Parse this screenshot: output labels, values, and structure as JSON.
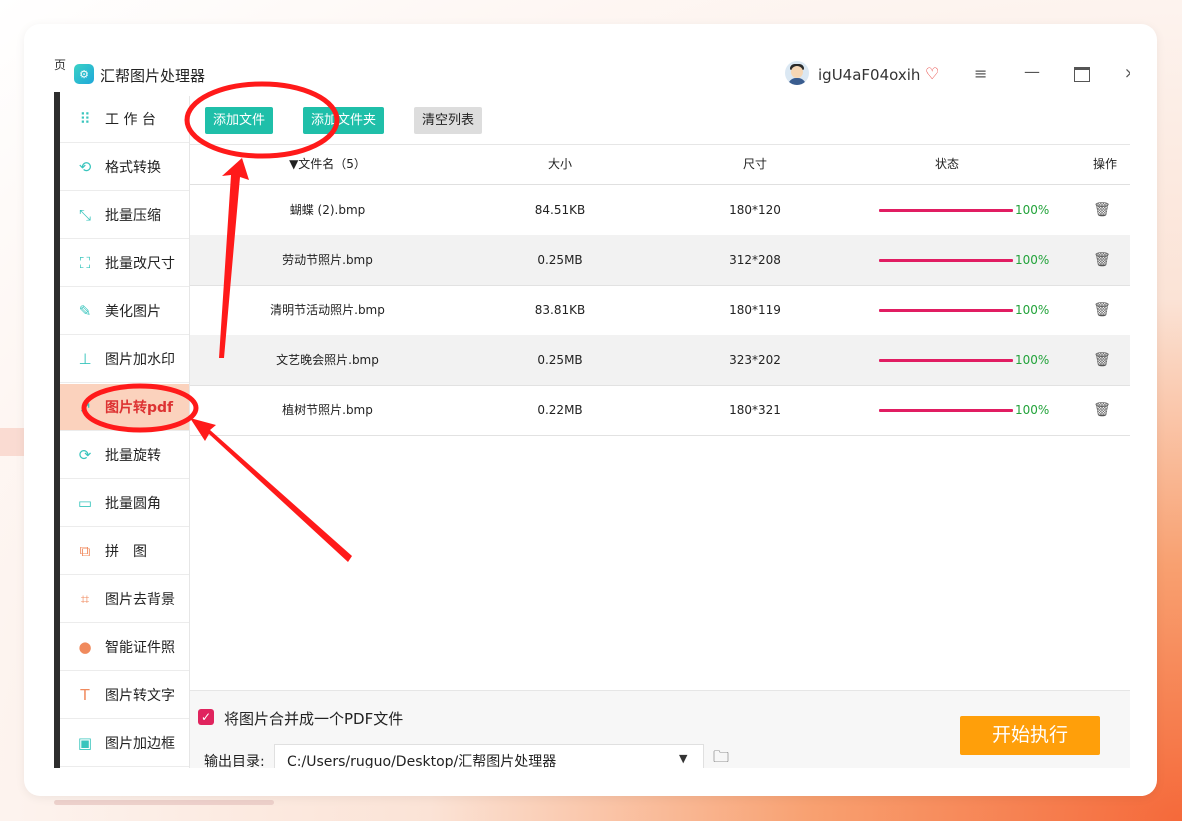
{
  "app": {
    "title": "汇帮图片处理器",
    "logo_glyph": "⚙",
    "edge_glyph": "页"
  },
  "user": {
    "name": "igU4aF04oxih"
  },
  "window_controls": {
    "menu": "≡",
    "minimize": "—",
    "close": "×"
  },
  "sidebar": {
    "items": [
      {
        "label": "工 作 台",
        "icon": "grid-icon",
        "glyph": "⠿"
      },
      {
        "label": "格式转换",
        "icon": "convert-icon",
        "glyph": "⟲"
      },
      {
        "label": "批量压缩",
        "icon": "compress-icon",
        "glyph": "⤡"
      },
      {
        "label": "批量改尺寸",
        "icon": "resize-icon",
        "glyph": "⛶"
      },
      {
        "label": "美化图片",
        "icon": "beautify-icon",
        "glyph": "✎"
      },
      {
        "label": "图片加水印",
        "icon": "watermark-icon",
        "glyph": "⊥"
      },
      {
        "label": "图片转pdf",
        "icon": "pdf-icon",
        "glyph": "↗",
        "active": true
      },
      {
        "label": "批量旋转",
        "icon": "rotate-icon",
        "glyph": "⟳"
      },
      {
        "label": "批量圆角",
        "icon": "corner-icon",
        "glyph": "▭"
      },
      {
        "label": "拼　图",
        "icon": "puzzle-icon",
        "glyph": "⧉"
      },
      {
        "label": "图片去背景",
        "icon": "crop-icon",
        "glyph": "⌗"
      },
      {
        "label": "智能证件照",
        "icon": "person-icon",
        "glyph": "●"
      },
      {
        "label": "图片转文字",
        "icon": "text-icon",
        "glyph": "T"
      },
      {
        "label": "图片加边框",
        "icon": "frame-icon",
        "glyph": "▣"
      }
    ]
  },
  "toolbar": {
    "add_file": "添加文件",
    "add_folder": "添加文件夹",
    "clear_list": "清空列表"
  },
  "table": {
    "headers": {
      "name": "▼文件名（5）",
      "size": "大小",
      "dim": "尺寸",
      "status": "状态",
      "op": "操作"
    },
    "rows": [
      {
        "name": "蝴蝶 (2).bmp",
        "size": "84.51KB",
        "dim": "180*120",
        "pct": "100%"
      },
      {
        "name": "劳动节照片.bmp",
        "size": "0.25MB",
        "dim": "312*208",
        "pct": "100%"
      },
      {
        "name": "清明节活动照片.bmp",
        "size": "83.81KB",
        "dim": "180*119",
        "pct": "100%"
      },
      {
        "name": "文艺晚会照片.bmp",
        "size": "0.25MB",
        "dim": "323*202",
        "pct": "100%"
      },
      {
        "name": "植树节照片.bmp",
        "size": "0.22MB",
        "dim": "180*321",
        "pct": "100%"
      }
    ]
  },
  "bottom": {
    "merge_label": "将图片合并成一个PDF文件",
    "output_label": "输出目录:",
    "output_path": "C:/Users/ruguo/Desktop/汇帮图片处理器",
    "start": "开始执行"
  },
  "colors": {
    "accent": "#1fbfa9",
    "progress": "#e11d62",
    "start": "#ff9f0a",
    "annotation": "#ff1a1a"
  }
}
